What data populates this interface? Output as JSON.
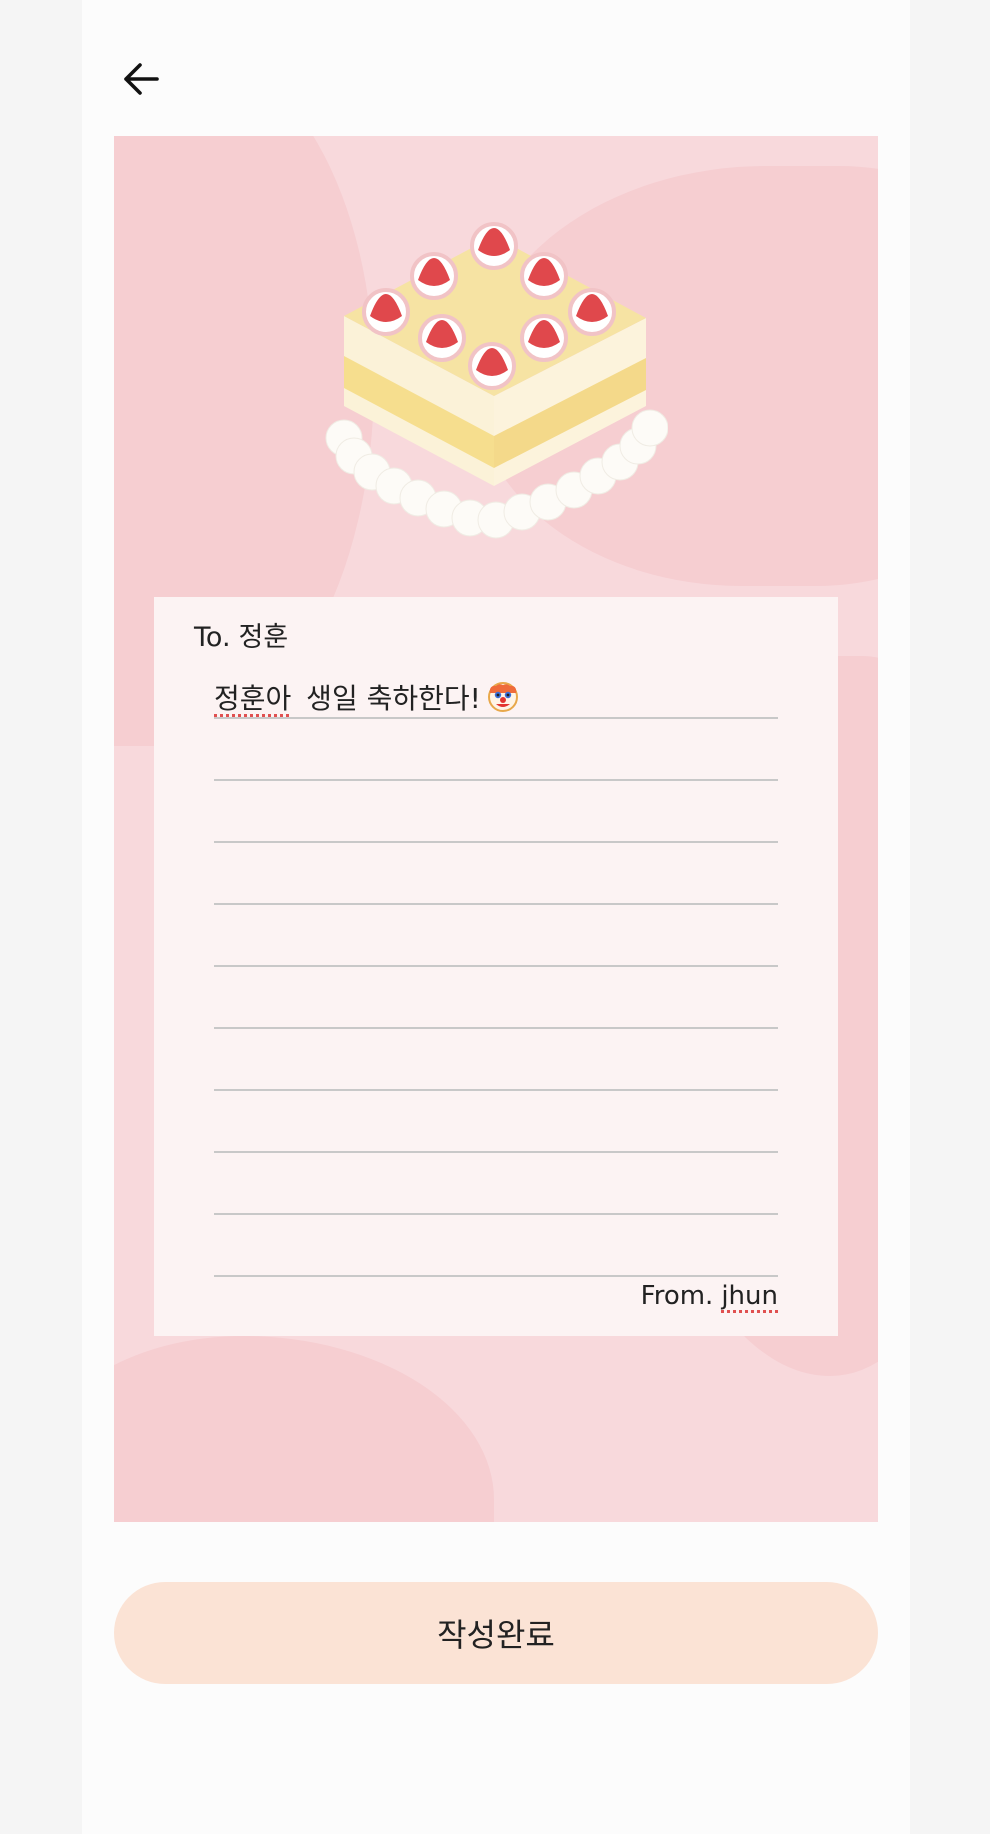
{
  "header": {
    "back_icon": "arrow-left-icon"
  },
  "card": {
    "illustration": "strawberry-cake",
    "background_color": "#f8d9dc",
    "letter": {
      "to_prefix": "To.",
      "to_name": "정훈",
      "message": {
        "text_part1": "정훈아",
        "text_part2": " 생일 축하한다!",
        "emoji": "clown-face"
      },
      "from_prefix": "From.",
      "from_name": "jhun",
      "line_count": 10
    }
  },
  "actions": {
    "submit_label": "작성완료",
    "submit_color": "#fbe3d5"
  }
}
